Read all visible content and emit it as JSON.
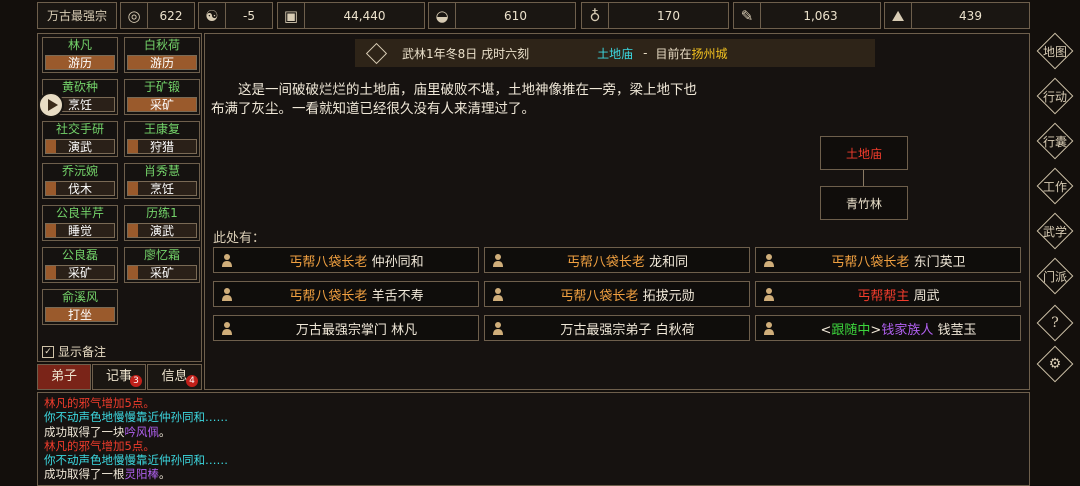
{
  "top": {
    "sect_name": "万古最强宗",
    "stats": [
      {
        "icon": "coin-icon",
        "glyph": "◎",
        "value": "622"
      },
      {
        "icon": "yin-yang-icon",
        "glyph": "☯",
        "value": "-5"
      },
      {
        "icon": "copper-coin-icon",
        "glyph": "▣",
        "value": "44,440"
      },
      {
        "icon": "food-bowl-icon",
        "glyph": "◒",
        "value": "610"
      },
      {
        "icon": "gourd-icon",
        "glyph": "♁",
        "value": "170"
      },
      {
        "icon": "scroll-icon",
        "glyph": "✎",
        "value": "1,063"
      },
      {
        "icon": "ore-icon",
        "glyph": "⛰",
        "value": "439"
      }
    ]
  },
  "disciples": [
    {
      "name": "林凡",
      "activity": "游历",
      "full": true
    },
    {
      "name": "白秋荷",
      "activity": "游历",
      "full": true
    },
    {
      "name": "黄砍种",
      "activity": "烹饪",
      "full": false
    },
    {
      "name": "于矿锻",
      "activity": "采矿",
      "full": true
    },
    {
      "name": "社交手研",
      "activity": "演武",
      "full": false
    },
    {
      "name": "王康复",
      "activity": "狩猎",
      "full": false
    },
    {
      "name": "乔沅婉",
      "activity": "伐木",
      "full": false
    },
    {
      "name": "肖秀慧",
      "activity": "烹饪",
      "full": false
    },
    {
      "name": "公良半芹",
      "activity": "睡觉",
      "full": false
    },
    {
      "name": "历练1",
      "activity": "演武",
      "full": false
    },
    {
      "name": "公良磊",
      "activity": "采矿",
      "full": false
    },
    {
      "name": "廖忆霜",
      "activity": "采矿",
      "full": false
    },
    {
      "name": "俞溪风",
      "activity": "打坐",
      "full": true
    }
  ],
  "show_notes_label": "显示备注",
  "tabs": [
    {
      "label": "弟子",
      "badge": ""
    },
    {
      "label": "记事",
      "badge": "3"
    },
    {
      "label": "信息",
      "badge": "4"
    }
  ],
  "header": {
    "date": "武林1年冬8日 戌时六刻",
    "place": "土地庙",
    "sep": "-",
    "location_prefix": "目前在",
    "city": "扬州城"
  },
  "description": "这是一间破破烂烂的土地庙，庙里破败不堪，土地神像推在一旁，梁上地下也布满了灰尘。一看就知道已经很久没有人来清理过了。",
  "map": {
    "current": "土地庙",
    "exit": "青竹林"
  },
  "here_label": "此处有：",
  "npcs": [
    {
      "title": "丐帮八袋长老",
      "title_color": "orange",
      "name": "仲孙同和"
    },
    {
      "title": "丐帮八袋长老",
      "title_color": "orange",
      "name": "龙和同"
    },
    {
      "title": "丐帮八袋长老",
      "title_color": "orange",
      "name": "东门英卫"
    },
    {
      "title": "丐帮八袋长老",
      "title_color": "orange",
      "name": "羊舌不寿"
    },
    {
      "title": "丐帮八袋长老",
      "title_color": "orange",
      "name": "拓拔元勋"
    },
    {
      "title": "丐帮帮主",
      "title_color": "red",
      "name": "周武"
    },
    {
      "title": "万古最强宗掌门",
      "title_color": "white",
      "name": "林凡"
    },
    {
      "title": "万古最强宗弟子",
      "title_color": "white",
      "name": "白秋荷"
    }
  ],
  "npc_follow": {
    "open": "<",
    "status": "跟随中",
    "close": ">",
    "clan": "钱家族人",
    "name": "钱莹玉"
  },
  "log": [
    {
      "parts": [
        {
          "t": "林凡的邪气增加5点。",
          "c": "red"
        }
      ]
    },
    {
      "parts": [
        {
          "t": "你不动声色地慢慢靠近仲孙同和……",
          "c": "cyan"
        }
      ]
    },
    {
      "parts": [
        {
          "t": "成功取得了一块",
          "c": "white"
        },
        {
          "t": "吟风佩",
          "c": "purple"
        },
        {
          "t": "。",
          "c": "white"
        }
      ]
    },
    {
      "parts": [
        {
          "t": "林凡的邪气增加5点。",
          "c": "red"
        }
      ]
    },
    {
      "parts": [
        {
          "t": "你不动声色地慢慢靠近仲孙同和……",
          "c": "cyan"
        }
      ]
    },
    {
      "parts": [
        {
          "t": "成功取得了一根",
          "c": "white"
        },
        {
          "t": "灵阳棒",
          "c": "purple"
        },
        {
          "t": "。",
          "c": "white"
        }
      ]
    }
  ],
  "right_menu": [
    {
      "icon": "map-icon",
      "label": "地图"
    },
    {
      "icon": "action-icon",
      "label": "行动"
    },
    {
      "icon": "bag-icon",
      "label": "行囊"
    },
    {
      "icon": "work-icon",
      "label": "工作"
    },
    {
      "icon": "martial-icon",
      "label": "武学"
    },
    {
      "icon": "sect-icon",
      "label": "门派"
    },
    {
      "icon": "help-icon",
      "label": "?"
    },
    {
      "icon": "settings-icon",
      "label": "⚙"
    }
  ],
  "colors": {
    "orange": "#f0a040",
    "red": "#f03c2c",
    "green": "#3cd43c",
    "purple": "#b060f0",
    "cyan": "#3cd8e0",
    "gold": "#f0c020"
  }
}
